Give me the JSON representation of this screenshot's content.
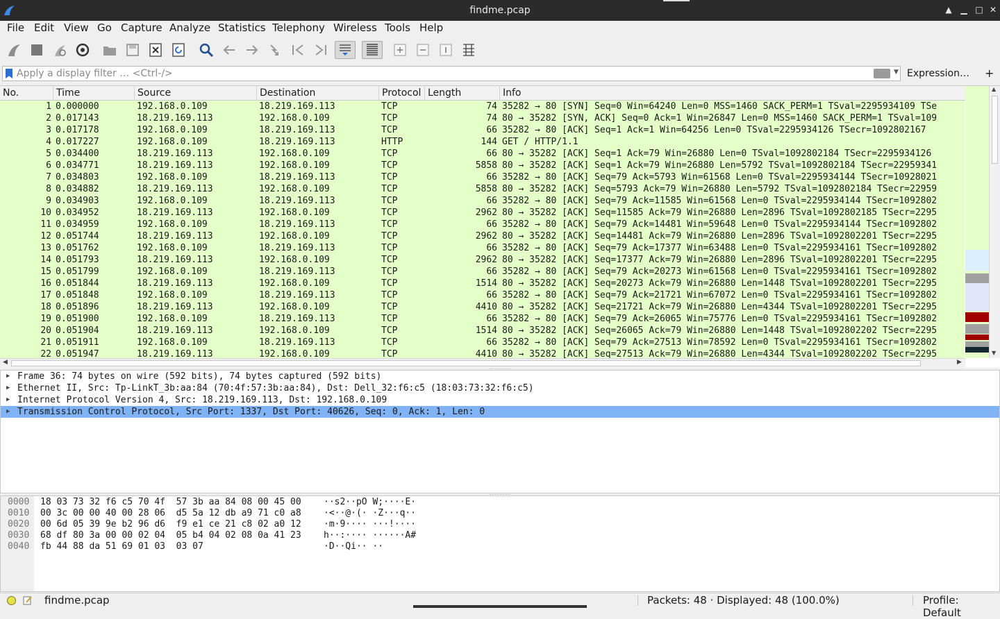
{
  "window": {
    "title": "findme.pcap"
  },
  "menu": [
    "File",
    "Edit",
    "View",
    "Go",
    "Capture",
    "Analyze",
    "Statistics",
    "Telephony",
    "Wireless",
    "Tools",
    "Help"
  ],
  "toolbar_icons": [
    "shark-fin-start-icon",
    "stop-icon",
    "restart-icon",
    "capture-options-icon",
    "open-file-icon",
    "save-file-icon",
    "close-file-icon",
    "reload-icon",
    "find-packet-icon",
    "go-back-icon",
    "go-forward-icon",
    "go-to-packet-icon",
    "first-packet-icon",
    "last-packet-icon",
    "autoscroll-icon",
    "colorize-icon",
    "zoom-in-icon",
    "zoom-out-icon",
    "normal-size-icon",
    "resize-columns-icon"
  ],
  "filter": {
    "placeholder": "Apply a display filter … <Ctrl-/>",
    "value": "",
    "expression_label": "Expression…",
    "add_label": "+"
  },
  "columns": [
    "No.",
    "Time",
    "Source",
    "Destination",
    "Protocol",
    "Length",
    "Info"
  ],
  "packets": [
    {
      "no": "1",
      "time": "0.000000",
      "src": "192.168.0.109",
      "dst": "18.219.169.113",
      "proto": "TCP",
      "len": "74",
      "info": "35282 → 80 [SYN] Seq=0 Win=64240 Len=0 MSS=1460 SACK_PERM=1 TSval=2295934109 TSe"
    },
    {
      "no": "2",
      "time": "0.017143",
      "src": "18.219.169.113",
      "dst": "192.168.0.109",
      "proto": "TCP",
      "len": "74",
      "info": "80 → 35282 [SYN, ACK] Seq=0 Ack=1 Win=26847 Len=0 MSS=1460 SACK_PERM=1 TSval=109"
    },
    {
      "no": "3",
      "time": "0.017178",
      "src": "192.168.0.109",
      "dst": "18.219.169.113",
      "proto": "TCP",
      "len": "66",
      "info": "35282 → 80 [ACK] Seq=1 Ack=1 Win=64256 Len=0 TSval=2295934126 TSecr=1092802167"
    },
    {
      "no": "4",
      "time": "0.017227",
      "src": "192.168.0.109",
      "dst": "18.219.169.113",
      "proto": "HTTP",
      "len": "144",
      "info": "GET / HTTP/1.1"
    },
    {
      "no": "5",
      "time": "0.034400",
      "src": "18.219.169.113",
      "dst": "192.168.0.109",
      "proto": "TCP",
      "len": "66",
      "info": "80 → 35282 [ACK] Seq=1 Ack=79 Win=26880 Len=0 TSval=1092802184 TSecr=2295934126"
    },
    {
      "no": "6",
      "time": "0.034771",
      "src": "18.219.169.113",
      "dst": "192.168.0.109",
      "proto": "TCP",
      "len": "5858",
      "info": "80 → 35282 [ACK] Seq=1 Ack=79 Win=26880 Len=5792 TSval=1092802184 TSecr=22959341"
    },
    {
      "no": "7",
      "time": "0.034803",
      "src": "192.168.0.109",
      "dst": "18.219.169.113",
      "proto": "TCP",
      "len": "66",
      "info": "35282 → 80 [ACK] Seq=79 Ack=5793 Win=61568 Len=0 TSval=2295934144 TSecr=10928021"
    },
    {
      "no": "8",
      "time": "0.034882",
      "src": "18.219.169.113",
      "dst": "192.168.0.109",
      "proto": "TCP",
      "len": "5858",
      "info": "80 → 35282 [ACK] Seq=5793 Ack=79 Win=26880 Len=5792 TSval=1092802184 TSecr=22959"
    },
    {
      "no": "9",
      "time": "0.034903",
      "src": "192.168.0.109",
      "dst": "18.219.169.113",
      "proto": "TCP",
      "len": "66",
      "info": "35282 → 80 [ACK] Seq=79 Ack=11585 Win=61568 Len=0 TSval=2295934144 TSecr=1092802"
    },
    {
      "no": "10",
      "time": "0.034952",
      "src": "18.219.169.113",
      "dst": "192.168.0.109",
      "proto": "TCP",
      "len": "2962",
      "info": "80 → 35282 [ACK] Seq=11585 Ack=79 Win=26880 Len=2896 TSval=1092802185 TSecr=2295"
    },
    {
      "no": "11",
      "time": "0.034959",
      "src": "192.168.0.109",
      "dst": "18.219.169.113",
      "proto": "TCP",
      "len": "66",
      "info": "35282 → 80 [ACK] Seq=79 Ack=14481 Win=59648 Len=0 TSval=2295934144 TSecr=1092802"
    },
    {
      "no": "12",
      "time": "0.051744",
      "src": "18.219.169.113",
      "dst": "192.168.0.109",
      "proto": "TCP",
      "len": "2962",
      "info": "80 → 35282 [ACK] Seq=14481 Ack=79 Win=26880 Len=2896 TSval=1092802201 TSecr=2295"
    },
    {
      "no": "13",
      "time": "0.051762",
      "src": "192.168.0.109",
      "dst": "18.219.169.113",
      "proto": "TCP",
      "len": "66",
      "info": "35282 → 80 [ACK] Seq=79 Ack=17377 Win=63488 Len=0 TSval=2295934161 TSecr=1092802"
    },
    {
      "no": "14",
      "time": "0.051793",
      "src": "18.219.169.113",
      "dst": "192.168.0.109",
      "proto": "TCP",
      "len": "2962",
      "info": "80 → 35282 [ACK] Seq=17377 Ack=79 Win=26880 Len=2896 TSval=1092802201 TSecr=2295"
    },
    {
      "no": "15",
      "time": "0.051799",
      "src": "192.168.0.109",
      "dst": "18.219.169.113",
      "proto": "TCP",
      "len": "66",
      "info": "35282 → 80 [ACK] Seq=79 Ack=20273 Win=61568 Len=0 TSval=2295934161 TSecr=1092802"
    },
    {
      "no": "16",
      "time": "0.051844",
      "src": "18.219.169.113",
      "dst": "192.168.0.109",
      "proto": "TCP",
      "len": "1514",
      "info": "80 → 35282 [ACK] Seq=20273 Ack=79 Win=26880 Len=1448 TSval=1092802201 TSecr=2295"
    },
    {
      "no": "17",
      "time": "0.051848",
      "src": "192.168.0.109",
      "dst": "18.219.169.113",
      "proto": "TCP",
      "len": "66",
      "info": "35282 → 80 [ACK] Seq=79 Ack=21721 Win=67072 Len=0 TSval=2295934161 TSecr=1092802"
    },
    {
      "no": "18",
      "time": "0.051896",
      "src": "18.219.169.113",
      "dst": "192.168.0.109",
      "proto": "TCP",
      "len": "4410",
      "info": "80 → 35282 [ACK] Seq=21721 Ack=79 Win=26880 Len=4344 TSval=1092802201 TSecr=2295"
    },
    {
      "no": "19",
      "time": "0.051900",
      "src": "192.168.0.109",
      "dst": "18.219.169.113",
      "proto": "TCP",
      "len": "66",
      "info": "35282 → 80 [ACK] Seq=79 Ack=26065 Win=75776 Len=0 TSval=2295934161 TSecr=1092802"
    },
    {
      "no": "20",
      "time": "0.051904",
      "src": "18.219.169.113",
      "dst": "192.168.0.109",
      "proto": "TCP",
      "len": "1514",
      "info": "80 → 35282 [ACK] Seq=26065 Ack=79 Win=26880 Len=1448 TSval=1092802202 TSecr=2295"
    },
    {
      "no": "21",
      "time": "0.051911",
      "src": "192.168.0.109",
      "dst": "18.219.169.113",
      "proto": "TCP",
      "len": "66",
      "info": "35282 → 80 [ACK] Seq=79 Ack=27513 Win=78592 Len=0 TSval=2295934161 TSecr=1092802"
    },
    {
      "no": "22",
      "time": "0.051947",
      "src": "18.219.169.113",
      "dst": "192.168.0.109",
      "proto": "TCP",
      "len": "4410",
      "info": "80 → 35282 [ACK] Seq=27513 Ack=79 Win=26880 Len=4344 TSval=1092802202 TSecr=2295"
    }
  ],
  "details": [
    {
      "text": "Frame 36: 74 bytes on wire (592 bits), 74 bytes captured (592 bits)",
      "selected": false
    },
    {
      "text": "Ethernet II, Src: Tp-LinkT_3b:aa:84 (70:4f:57:3b:aa:84), Dst: Dell_32:f6:c5 (18:03:73:32:f6:c5)",
      "selected": false
    },
    {
      "text": "Internet Protocol Version 4, Src: 18.219.169.113, Dst: 192.168.0.109",
      "selected": false
    },
    {
      "text": "Transmission Control Protocol, Src Port: 1337, Dst Port: 40626, Seq: 0, Ack: 1, Len: 0",
      "selected": true
    }
  ],
  "bytes": [
    {
      "offset": "0000",
      "hex": "18 03 73 32 f6 c5 70 4f  57 3b aa 84 08 00 45 00",
      "ascii": "··s2··pO W;····E·"
    },
    {
      "offset": "0010",
      "hex": "00 3c 00 00 40 00 28 06  d5 5a 12 db a9 71 c0 a8",
      "ascii": "·<··@·(· ·Z···q··"
    },
    {
      "offset": "0020",
      "hex": "00 6d 05 39 9e b2 96 d6  f9 e1 ce 21 c8 02 a0 12",
      "ascii": "·m·9···· ···!····"
    },
    {
      "offset": "0030",
      "hex": "68 df 80 3a 00 00 02 04  05 b4 04 02 08 0a 41 23",
      "ascii": "h··:···· ······A#"
    },
    {
      "offset": "0040",
      "hex": "fb 44 88 da 51 69 01 03  03 07",
      "ascii": "·D··Qi·· ··"
    }
  ],
  "status": {
    "file": "findme.pcap",
    "packets": "Packets: 48 · Displayed: 48 (100.0%)",
    "profile": "Profile: Default"
  },
  "colors": {
    "tcp_row": "#e4ffc7",
    "selected": "#7fb3f5",
    "accent": "#2a6fd6"
  }
}
